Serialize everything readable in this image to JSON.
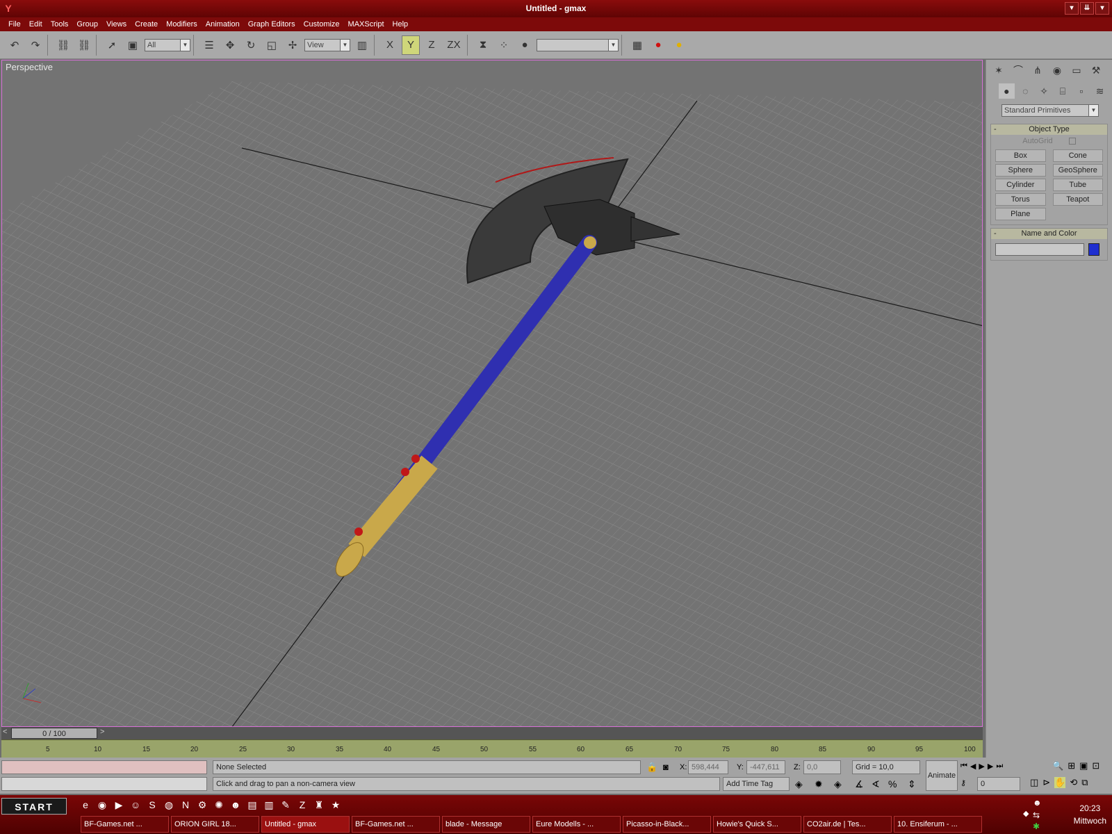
{
  "window": {
    "title": "Untitled - gmax",
    "min": "▾",
    "restore": "⇊",
    "close": "▾"
  },
  "menu": [
    "File",
    "Edit",
    "Tools",
    "Group",
    "Views",
    "Create",
    "Modifiers",
    "Animation",
    "Graph Editors",
    "Customize",
    "MAXScript",
    "Help"
  ],
  "toolbar": {
    "undo_icon": "undo-icon",
    "selection_filter": "All",
    "ref_coord": "View",
    "axis_x": "X",
    "axis_y": "Y",
    "axis_z": "Z",
    "axis_zx": "ZX",
    "named_selection": ""
  },
  "viewport": {
    "label": "Perspective"
  },
  "command_panel": {
    "category": "Standard Primitives",
    "object_type_title": "Object Type",
    "autogrid_label": "AutoGrid",
    "buttons": [
      "Box",
      "Cone",
      "Sphere",
      "GeoSphere",
      "Cylinder",
      "Tube",
      "Torus",
      "Teapot",
      "Plane"
    ],
    "name_color_title": "Name and Color",
    "name_value": "",
    "object_color": "#1f2fd0",
    "collapse_sign": "-"
  },
  "timeline": {
    "slider": "0 / 100",
    "prev": "<",
    "next": ">",
    "ticks": [
      "5",
      "10",
      "15",
      "20",
      "25",
      "30",
      "35",
      "40",
      "45",
      "50",
      "55",
      "60",
      "65",
      "70",
      "75",
      "80",
      "85",
      "90",
      "95",
      "100"
    ]
  },
  "status": {
    "selection": "None Selected",
    "prompt": "Click and drag to pan a non-camera view",
    "x_label": "X:",
    "x_value": "598,444",
    "y_label": "Y:",
    "y_value": "-447,611",
    "z_label": "Z:",
    "z_value": "0,0",
    "grid": "Grid = 10,0",
    "add_time_tag": "Add Time Tag",
    "animate": "Animate",
    "frame": "0"
  },
  "taskbar": {
    "start": "START",
    "tasks": [
      "BF-Games.net ...",
      "ORION GIRL 18...",
      "Untitled - gmax",
      "BF-Games.net ...",
      "blade - Message",
      "Eure Modells - ...",
      "Picasso-in-Black...",
      "Howie's Quick S...",
      "CO2air.de | Tes...",
      "10. Ensiferum - ..."
    ],
    "active_index": 2,
    "time": "20:23",
    "day": "Mittwoch"
  },
  "colors": {
    "title_red": "#7d0a0a",
    "handle_blue": "#2f2fb0",
    "blade_gray": "#3c3c3c",
    "gold": "#c9a84a",
    "gem_red": "#c01818"
  }
}
